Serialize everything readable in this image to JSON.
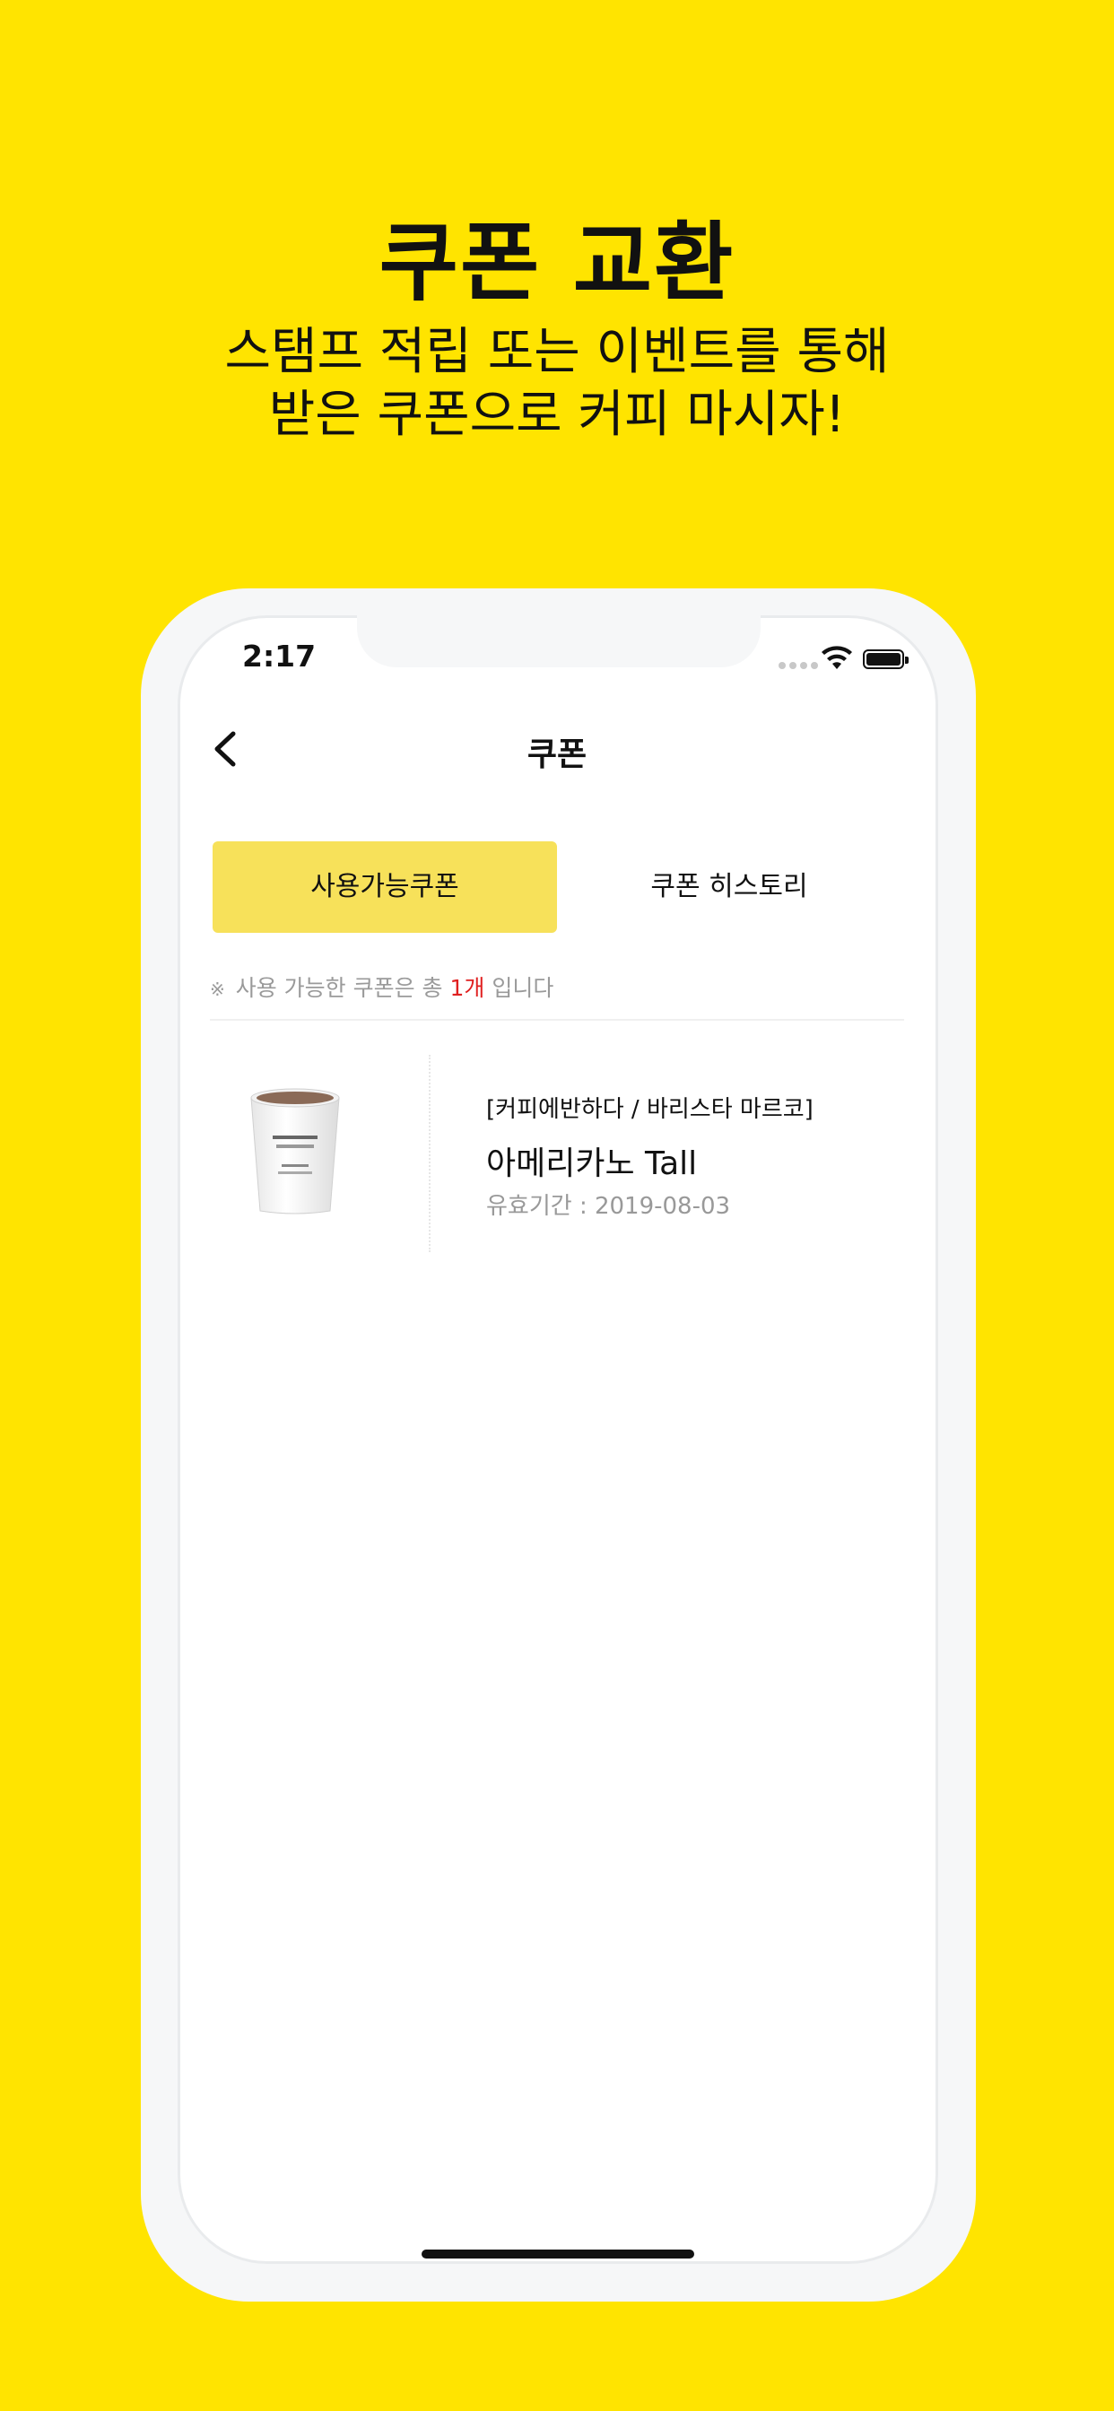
{
  "promo": {
    "headline": "쿠폰 교환",
    "sub_line1": "스탬프 적립 또는 이벤트를 통해",
    "sub_line2": "받은 쿠폰으로 커피 마시자!"
  },
  "status_bar": {
    "time": "2:17"
  },
  "nav": {
    "title": "쿠폰"
  },
  "tabs": [
    {
      "label": "사용가능쿠폰",
      "active": true
    },
    {
      "label": "쿠폰 히스토리",
      "active": false
    }
  ],
  "notice": {
    "mark": "※",
    "prefix": "사용 가능한 쿠폰은 총",
    "count": "1개",
    "suffix": "입니다"
  },
  "coupons": [
    {
      "brand": "[커피에반하다 / 바리스타 마르코]",
      "name": "아메리카노 Tall",
      "expiry": "유효기간 : 2019-08-03"
    }
  ],
  "colors": {
    "background": "#FFE400",
    "tab_active": "#F7E15A",
    "accent_red": "#E02020"
  }
}
